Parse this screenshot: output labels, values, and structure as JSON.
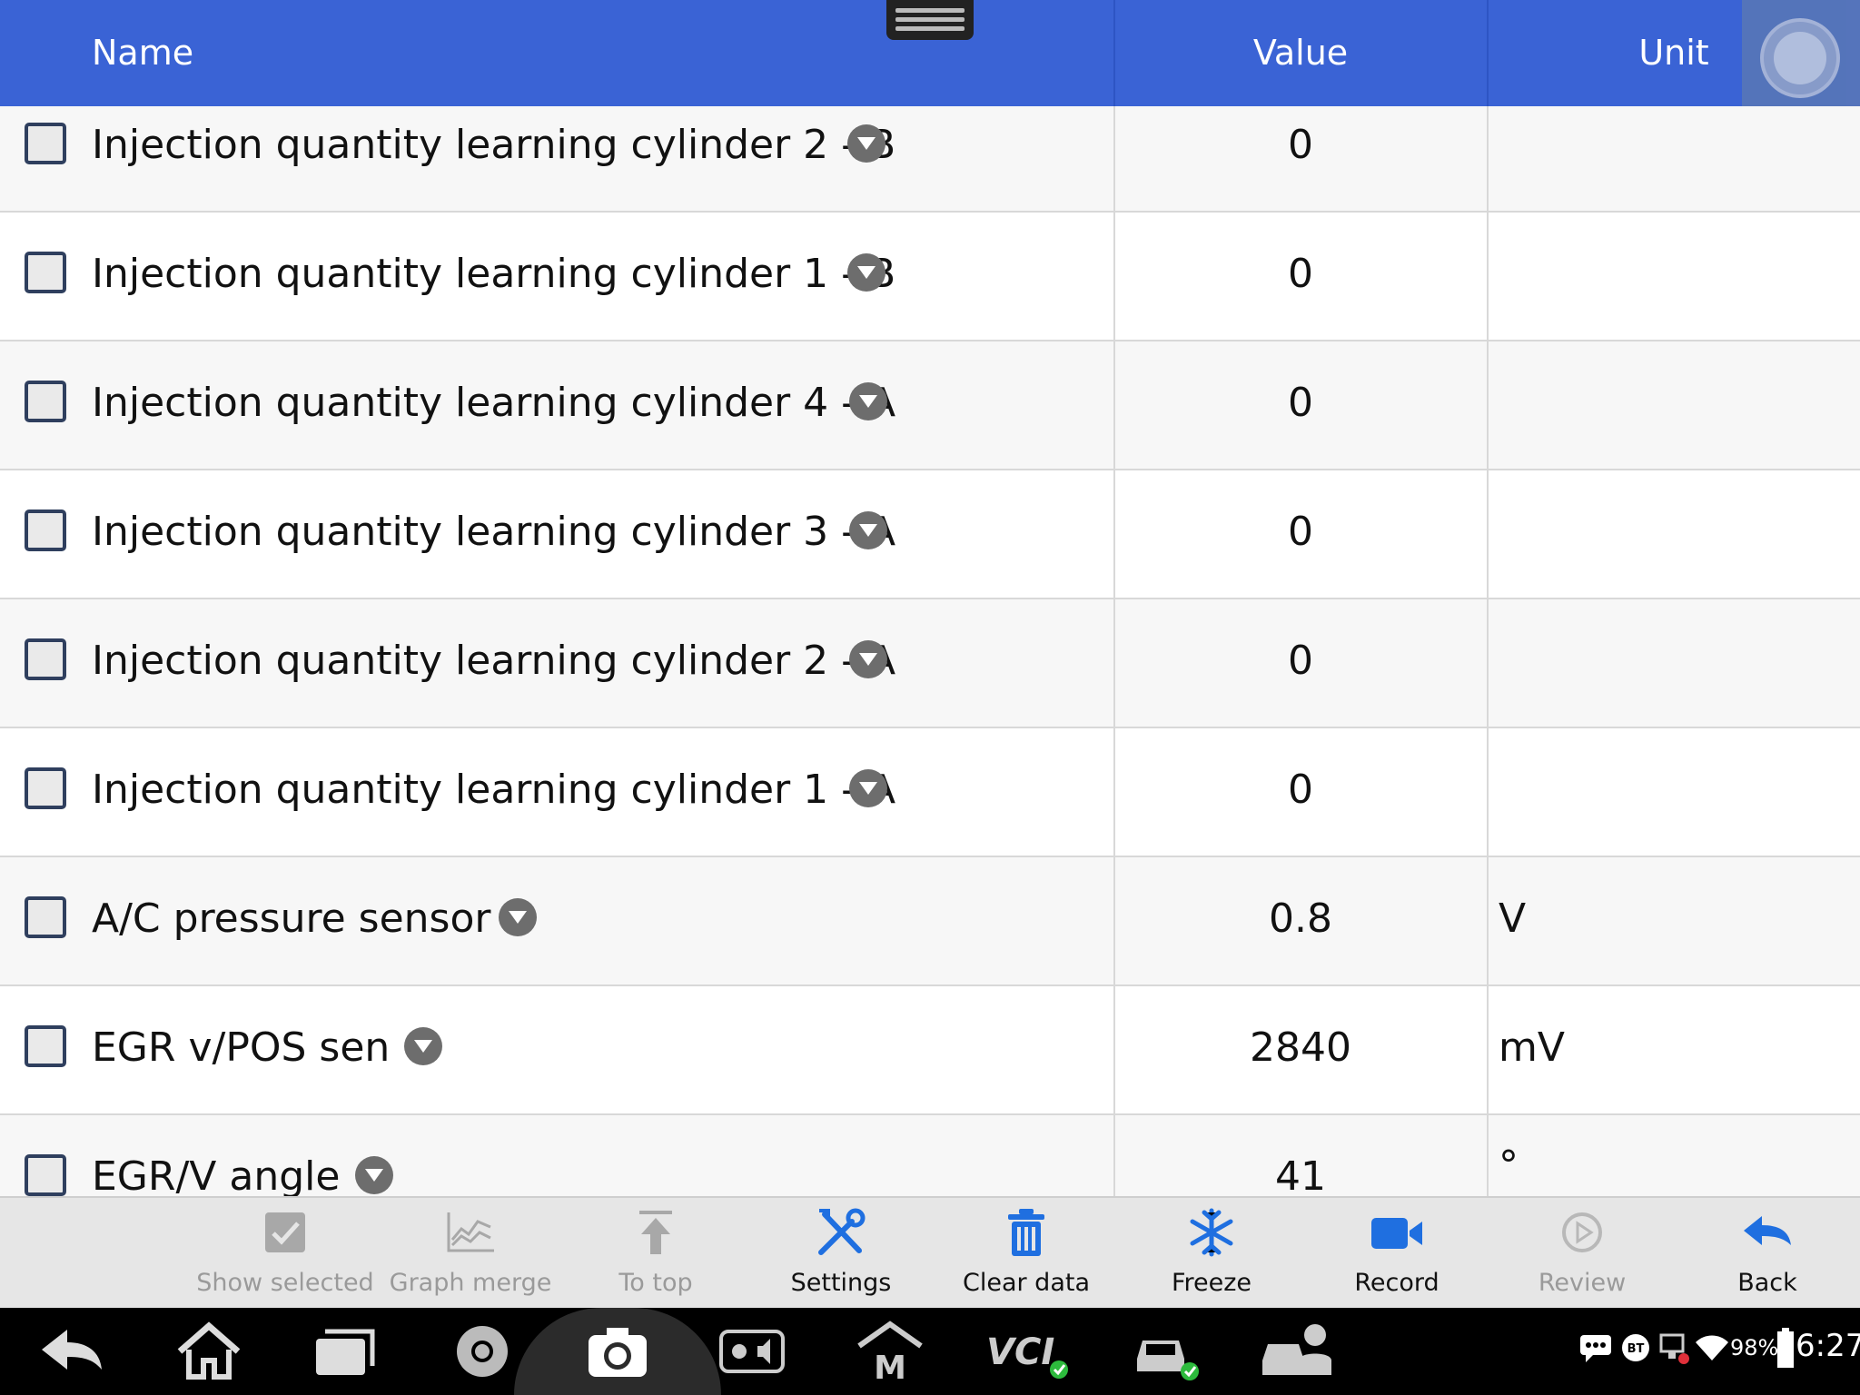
{
  "header": {
    "name_label": "Name",
    "value_label": "Value",
    "unit_label": "Unit"
  },
  "rows": [
    {
      "name": "Injection quantity learning cylinder 2 - B",
      "value": "0",
      "unit": ""
    },
    {
      "name": "Injection quantity learning cylinder 1 - B",
      "value": "0",
      "unit": ""
    },
    {
      "name": "Injection quantity learning cylinder 4 - A",
      "value": "0",
      "unit": ""
    },
    {
      "name": "Injection quantity learning cylinder 3 - A",
      "value": "0",
      "unit": ""
    },
    {
      "name": "Injection quantity learning cylinder 2 - A",
      "value": "0",
      "unit": ""
    },
    {
      "name": "Injection quantity learning cylinder 1 - A",
      "value": "0",
      "unit": ""
    },
    {
      "name": "A/C pressure sensor",
      "value": "0.8",
      "unit": "V"
    },
    {
      "name": "EGR v/POS sen",
      "value": "2840",
      "unit": "mV"
    },
    {
      "name": "EGR/V angle",
      "value": "41",
      "unit": "°"
    }
  ],
  "toolbar": [
    {
      "label": "Show selected",
      "icon": "checkbox-icon",
      "enabled": false
    },
    {
      "label": "Graph merge",
      "icon": "graph-merge-icon",
      "enabled": false
    },
    {
      "label": "To top",
      "icon": "arrow-to-top-icon",
      "enabled": false
    },
    {
      "label": "Settings",
      "icon": "wrench-screwdriver-icon",
      "enabled": true
    },
    {
      "label": "Clear data",
      "icon": "trash-icon",
      "enabled": true
    },
    {
      "label": "Freeze",
      "icon": "snowflake-icon",
      "enabled": true
    },
    {
      "label": "Record",
      "icon": "video-camera-icon",
      "enabled": true
    },
    {
      "label": "Review",
      "icon": "play-circle-icon",
      "enabled": false
    },
    {
      "label": "Back",
      "icon": "back-arrow-icon",
      "enabled": true
    }
  ],
  "system_bar": {
    "battery": "98%",
    "time": "6:27",
    "vci_label": "VCI",
    "bt_label": "BT",
    "m_label": "M"
  },
  "colors": {
    "header_bg": "#3a63d5",
    "accent_blue": "#1f6fe0",
    "disabled_gray": "#9a9a9a"
  }
}
